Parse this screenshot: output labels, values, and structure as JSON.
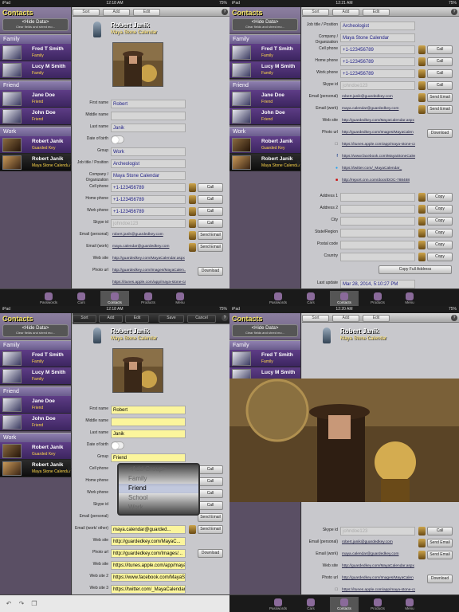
{
  "status": {
    "carrier": "iPad",
    "wifi": "wifi-icon",
    "times": [
      "12:18 AM",
      "12:21 AM",
      "12:18 AM",
      "12:20 AM"
    ],
    "battery": "75%"
  },
  "app": {
    "title": "Contacts",
    "hide_title": "<Hide Data>",
    "hide_sub": "Clear fields and shred mo..."
  },
  "toolbar": {
    "sort": "Sort",
    "add": "Add",
    "edit": "Edit",
    "save": "Save",
    "cancel": "Cancel",
    "help": "?"
  },
  "groups": [
    {
      "name": "Family",
      "items": [
        {
          "name": "Fred T Smith",
          "sub": "Family"
        },
        {
          "name": "Lucy M Smith",
          "sub": "Family"
        }
      ]
    },
    {
      "name": "Friend",
      "items": [
        {
          "name": "Jane Doe",
          "sub": "Friend"
        },
        {
          "name": "John Doe",
          "sub": "Friend"
        }
      ]
    },
    {
      "name": "Work",
      "items": [
        {
          "name": "Robert Janik",
          "sub": "Guarded Key"
        },
        {
          "name": "Robert Janik",
          "sub": "Maya Stone Calendar"
        }
      ]
    }
  ],
  "contact": {
    "name": "Robert Janik",
    "company": "Maya Stone Calendar"
  },
  "labels": {
    "first": "First name",
    "middle": "Middle name",
    "last": "Last name",
    "dob": "Date of birth",
    "group": "Group",
    "job": "Job title / Position",
    "comp": "Company / Organization",
    "cell": "Cell phone",
    "home": "Home phone",
    "work": "Work phone",
    "skype": "Skype id",
    "emailp": "Email (personal)",
    "emailw": "Email (work)",
    "website": "Web site",
    "photourl": "Photo url",
    "addr1": "Address 1",
    "addr2": "Address 2",
    "city": "City",
    "state": "State/Region",
    "postal": "Postal code",
    "country": "Country",
    "lastupd": "Last update",
    "emailwp": "Email (work/ other)",
    "website2": "Web site 2",
    "website3": "Web site 3"
  },
  "values": {
    "first": "Robert",
    "last": "Janik",
    "group": "Work",
    "group_edit": "Friend",
    "job": "Archeologist",
    "comp": "Maya Stone Calendar",
    "phone": "+1-123456789",
    "skype": "johndoe123",
    "emailp": "robert.janik@guardedkey.com",
    "emailw": "maya.calendar@guardedkey.com",
    "website": "http://guardedkey.com/MayaCalendar.aspx",
    "photourl": "http://guardedkey.com/Images/MayaCalen...",
    "photourl2": "http://guardedkey.com/Images/MayaCalen",
    "appurl": "https://itunes.apple.com/app/maya-stone-calendar/id483942457",
    "fburl": "https://www.facebook.com/MayaStoneCalendar",
    "twurl": "https://twitter.com/_MayaCalendar_",
    "cnnurl": "http://report.cnn.com/docs/DOC-788488",
    "lastupd": "Mar 28, 2014, 5:10:27 PM",
    "email_edit": "maya.calendar@guarded...",
    "website_edit": "http://guardedkey.com/MayaC...",
    "photourl_edit": "http://guardedkey.com/Images/...",
    "appurl_edit": "https://itunes.apple.com/app/maya-stone-calenda...",
    "fburl_edit": "https://www.facebook.com/MayaStoneCalendar",
    "twurl_edit": "https://twitter.com/_MayaCalendar_"
  },
  "actions": {
    "call": "Call",
    "send": "Send Email",
    "download": "Download",
    "copy": "Copy",
    "copyfull": "Copy Full Address"
  },
  "picker": [
    "<Add Group>",
    "Family",
    "Friend",
    "School",
    "Work"
  ],
  "tabs": [
    "Passwords",
    "Cars",
    "Contacts",
    "Products",
    "Menu"
  ],
  "colors": {
    "accent": "#ffe060",
    "group_bg": "#7a6c9c",
    "toolbar_edit": "#2a2a2a"
  }
}
